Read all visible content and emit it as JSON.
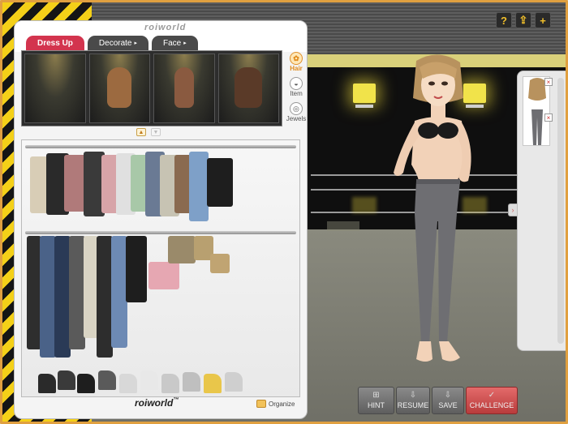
{
  "game": {
    "brand_top": "roiworld",
    "brand_bottom": "roiworld",
    "brand_tm": "™"
  },
  "tabs": [
    {
      "label": "Dress Up",
      "active": true
    },
    {
      "label": "Decorate",
      "active": false,
      "caret": "▸"
    },
    {
      "label": "Face",
      "active": false,
      "caret": "▸"
    }
  ],
  "categories": [
    {
      "label": "Hair",
      "icon": "hair-icon",
      "active": true
    },
    {
      "label": "Item",
      "icon": "hat-icon",
      "active": false
    },
    {
      "label": "Jewels",
      "icon": "ring-icon",
      "active": false
    }
  ],
  "hair_previews": [
    {
      "color": "#000000",
      "empty": true
    },
    {
      "color": "#9c6a40"
    },
    {
      "color": "#8a5a40"
    },
    {
      "color": "#5a3a28"
    }
  ],
  "pager": {
    "up": "▲",
    "down": "▼"
  },
  "organize_label": "Organize",
  "top_icons": [
    {
      "icon": "help-icon",
      "glyph": "?"
    },
    {
      "icon": "upload-icon",
      "glyph": "⇪"
    },
    {
      "icon": "plus-icon",
      "glyph": "+"
    }
  ],
  "side_panel": {
    "close_glyph": "×",
    "arrow_glyph": "›"
  },
  "actions": [
    {
      "label": "HINT",
      "glyph": "⊞"
    },
    {
      "label": "RESUME",
      "glyph": "⇩"
    },
    {
      "label": "SAVE",
      "glyph": "⇩"
    },
    {
      "label": "CHALLENGE",
      "glyph": "✓"
    }
  ],
  "colors": {
    "accent": "#d3344e",
    "hazard_yellow": "#f4d018",
    "lamp": "#f1e34a"
  }
}
